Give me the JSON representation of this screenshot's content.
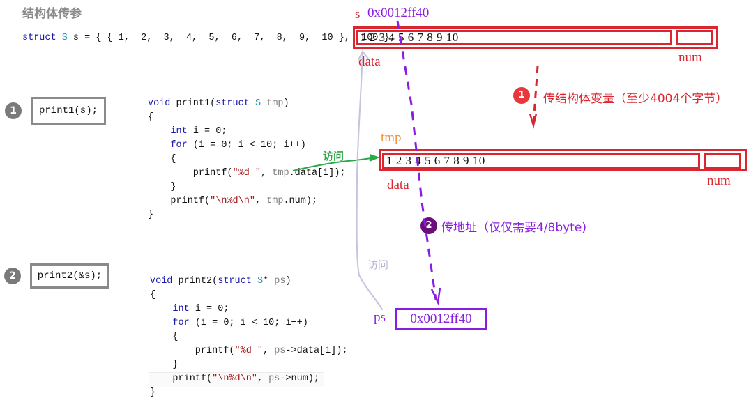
{
  "title": "结构体传参",
  "declaration": {
    "kw": "struct",
    "type": "S",
    "rest": " s = { { 1,  2,  3,  4,  5,  6,  7,  8,  9,  10 },  100 };"
  },
  "call1": {
    "badge": "1",
    "label": "print1(s);"
  },
  "call2": {
    "badge": "2",
    "label": "print2(&s);"
  },
  "func1": {
    "lines": [
      {
        "parts": [
          {
            "t": "void",
            "c": "kw"
          },
          {
            "t": " print1(",
            "c": ""
          },
          {
            "t": "struct",
            "c": "kw"
          },
          {
            "t": " ",
            "c": ""
          },
          {
            "t": "S",
            "c": "ty"
          },
          {
            "t": " tmp",
            "c": "var"
          },
          {
            "t": ")",
            "c": ""
          }
        ]
      },
      {
        "parts": [
          {
            "t": "{",
            "c": ""
          }
        ]
      },
      {
        "parts": [
          {
            "t": "    ",
            "c": ""
          },
          {
            "t": "int",
            "c": "kw"
          },
          {
            "t": " i = 0;",
            "c": ""
          }
        ]
      },
      {
        "parts": [
          {
            "t": "    ",
            "c": ""
          },
          {
            "t": "for",
            "c": "kw"
          },
          {
            "t": " (i = 0; i < 10; i++)",
            "c": ""
          }
        ]
      },
      {
        "parts": [
          {
            "t": "    {",
            "c": ""
          }
        ]
      },
      {
        "parts": [
          {
            "t": "        printf(",
            "c": ""
          },
          {
            "t": "\"%d \"",
            "c": "str"
          },
          {
            "t": ", ",
            "c": ""
          },
          {
            "t": "tmp",
            "c": "var"
          },
          {
            "t": ".data[i]);",
            "c": ""
          }
        ]
      },
      {
        "parts": [
          {
            "t": "    }",
            "c": ""
          }
        ]
      },
      {
        "parts": [
          {
            "t": "    printf(",
            "c": ""
          },
          {
            "t": "\"\\n%d\\n\"",
            "c": "str"
          },
          {
            "t": ", ",
            "c": ""
          },
          {
            "t": "tmp",
            "c": "var"
          },
          {
            "t": ".num);",
            "c": ""
          }
        ]
      },
      {
        "parts": [
          {
            "t": "}",
            "c": ""
          }
        ]
      }
    ]
  },
  "func2": {
    "lines": [
      {
        "parts": [
          {
            "t": "void",
            "c": "kw"
          },
          {
            "t": " print2(",
            "c": ""
          },
          {
            "t": "struct",
            "c": "kw"
          },
          {
            "t": " ",
            "c": ""
          },
          {
            "t": "S",
            "c": "ty"
          },
          {
            "t": "* ",
            "c": ""
          },
          {
            "t": "ps",
            "c": "var"
          },
          {
            "t": ")",
            "c": ""
          }
        ]
      },
      {
        "parts": [
          {
            "t": "{",
            "c": ""
          }
        ]
      },
      {
        "parts": [
          {
            "t": "    ",
            "c": ""
          },
          {
            "t": "int",
            "c": "kw"
          },
          {
            "t": " i = 0;",
            "c": ""
          }
        ]
      },
      {
        "parts": [
          {
            "t": "    ",
            "c": ""
          },
          {
            "t": "for",
            "c": "kw"
          },
          {
            "t": " (i = 0; i < 10; i++)",
            "c": ""
          }
        ]
      },
      {
        "parts": [
          {
            "t": "    {",
            "c": ""
          }
        ]
      },
      {
        "parts": [
          {
            "t": "        printf(",
            "c": ""
          },
          {
            "t": "\"%d \"",
            "c": "str"
          },
          {
            "t": ", ",
            "c": ""
          },
          {
            "t": "ps",
            "c": "var"
          },
          {
            "t": "->data[i]);",
            "c": ""
          }
        ]
      },
      {
        "parts": [
          {
            "t": "    }",
            "c": ""
          }
        ]
      },
      {
        "parts": [
          {
            "t": "    printf(",
            "c": ""
          },
          {
            "t": "\"\\n%d\\n\"",
            "c": "str"
          },
          {
            "t": ", ",
            "c": ""
          },
          {
            "t": "ps",
            "c": "var"
          },
          {
            "t": "->num);",
            "c": ""
          }
        ]
      },
      {
        "parts": [
          {
            "t": "}",
            "c": ""
          }
        ]
      }
    ]
  },
  "memory_s": {
    "var_label": "s",
    "address": "0x0012ff40",
    "cells": "1 2 3 4 5 6 7 8 9 10",
    "data_label": "data",
    "num_label": "num"
  },
  "memory_tmp": {
    "var_label": "tmp",
    "cells": "1 2 3 4 5 6 7 8 9 10",
    "data_label": "data",
    "num_label": "num"
  },
  "pointer_ps": {
    "var_label": "ps",
    "value": "0x0012ff40"
  },
  "annotations": {
    "step1_badge": "1",
    "step1_text": "传结构体变量（至少4004个字节）",
    "step2_badge": "2",
    "step2_text": "传地址（仅仅需要4/8byte)",
    "access_green": "访问",
    "access_gray": "访问"
  },
  "colors": {
    "red": "#d9262f",
    "purple": "#8a1ee0",
    "green": "#2aa84a",
    "gray_arrow": "#c4c4dc",
    "orange": "#f0923a",
    "badge_red": "#e8383d",
    "badge_purple": "#6a0f7a"
  }
}
